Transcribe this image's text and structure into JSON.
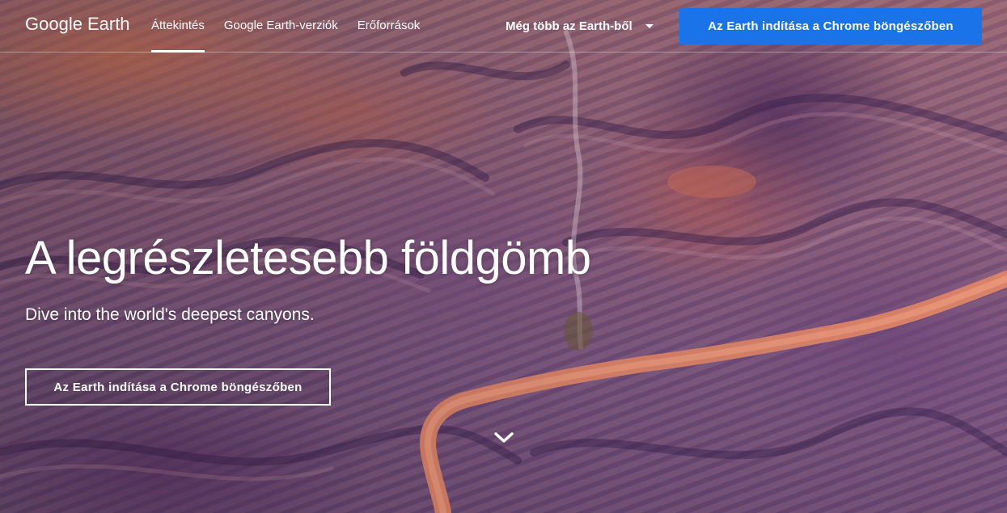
{
  "header": {
    "logo_google": "Google",
    "logo_earth": "Earth",
    "nav": [
      {
        "label": "Áttekintés",
        "active": true
      },
      {
        "label": "Google Earth-verziók",
        "active": false
      },
      {
        "label": "Erőforrások",
        "active": false
      }
    ],
    "more_label": "Még több az Earth-ből",
    "more_icon": "caret-down-icon",
    "launch_button": "Az Earth indítása a Chrome böngészőben"
  },
  "hero": {
    "title": "A legrészletesebb földgömb",
    "subtitle": "Dive into the world's deepest canyons.",
    "cta": "Az Earth indítása a Chrome böngészőben",
    "scroll_icon": "chevron-down-icon"
  },
  "colors": {
    "primary_button": "#1a73e8",
    "text": "#ffffff",
    "river": "#d9826a"
  }
}
